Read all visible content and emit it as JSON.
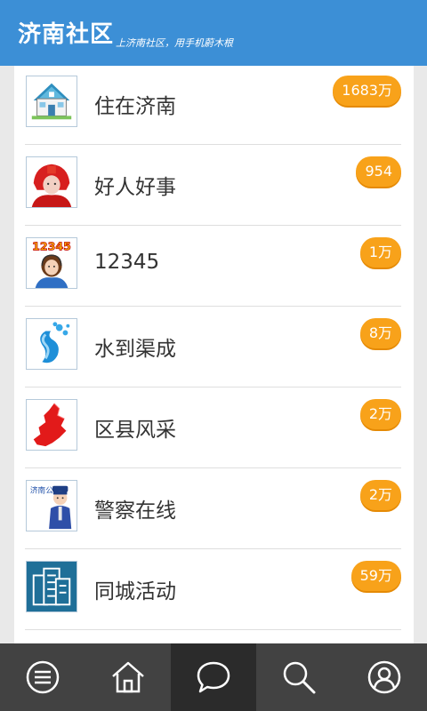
{
  "header": {
    "title": "济南社区",
    "slogan": "上济南社区，用手机蔚木根"
  },
  "items": [
    {
      "label": "住在济南",
      "count": "1683万",
      "icon": "house-icon"
    },
    {
      "label": "好人好事",
      "count": "954",
      "icon": "hero-portrait-icon"
    },
    {
      "label": "12345",
      "count": "1万",
      "icon": "hotline-operator-icon"
    },
    {
      "label": "水到渠成",
      "count": "8万",
      "icon": "water-splash-icon"
    },
    {
      "label": "区县风采",
      "count": "2万",
      "icon": "district-map-icon"
    },
    {
      "label": "警察在线",
      "count": "2万",
      "icon": "police-officer-icon"
    },
    {
      "label": "同城活动",
      "count": "59万",
      "icon": "buildings-icon"
    }
  ],
  "icon_texts": {
    "hotline_number": "12345",
    "police_caption": "济南公安"
  },
  "tabbar": {
    "tabs": [
      {
        "name": "menu-icon"
      },
      {
        "name": "home-icon"
      },
      {
        "name": "chat-icon",
        "active": true
      },
      {
        "name": "search-icon"
      },
      {
        "name": "profile-icon"
      }
    ]
  },
  "colors": {
    "header": "#3c8fd6",
    "badge": "#f8a21a",
    "tabbar": "#424242",
    "tab_active": "#2b2b2b"
  }
}
